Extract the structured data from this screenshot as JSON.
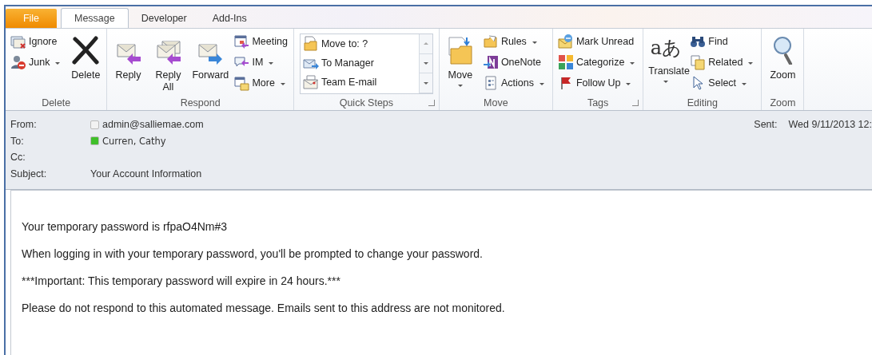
{
  "tabs": [
    {
      "label": "File",
      "kind": "file",
      "selected": false
    },
    {
      "label": "Message",
      "kind": "tab",
      "selected": true
    },
    {
      "label": "Developer",
      "kind": "tab",
      "selected": false
    },
    {
      "label": "Add-Ins",
      "kind": "tab",
      "selected": false
    }
  ],
  "groups": [
    {
      "label": "Delete",
      "launcher": false,
      "columns": [
        {
          "kind": "small",
          "items": [
            {
              "label": "Ignore",
              "dropdown": false
            },
            {
              "label": "Junk",
              "dropdown": true
            }
          ]
        },
        {
          "kind": "large",
          "items": [
            {
              "label": "Delete",
              "dropdown": false
            }
          ]
        }
      ]
    },
    {
      "label": "Respond",
      "launcher": false,
      "columns": [
        {
          "kind": "large",
          "items": [
            {
              "label": "Reply",
              "dropdown": false
            }
          ]
        },
        {
          "kind": "large",
          "items": [
            {
              "label": "Reply All",
              "dropdown": false
            }
          ]
        },
        {
          "kind": "large",
          "items": [
            {
              "label": "Forward",
              "dropdown": false
            }
          ]
        },
        {
          "kind": "small",
          "items": [
            {
              "label": "Meeting",
              "dropdown": false
            },
            {
              "label": "IM",
              "dropdown": true
            },
            {
              "label": "More",
              "dropdown": true
            }
          ]
        }
      ]
    },
    {
      "label": "Quick Steps",
      "launcher": true,
      "columns": [
        {
          "kind": "gallery",
          "items": [
            {
              "label": "Move to: ?",
              "dropdown": false
            },
            {
              "label": "To Manager",
              "dropdown": false
            },
            {
              "label": "Team E-mail",
              "dropdown": false
            }
          ]
        }
      ]
    },
    {
      "label": "Move",
      "launcher": false,
      "columns": [
        {
          "kind": "large",
          "items": [
            {
              "label": "Move",
              "dropdown": true
            }
          ]
        },
        {
          "kind": "small",
          "items": [
            {
              "label": "Rules",
              "dropdown": true
            },
            {
              "label": "OneNote",
              "dropdown": false
            },
            {
              "label": "Actions",
              "dropdown": true
            }
          ]
        }
      ]
    },
    {
      "label": "Tags",
      "launcher": true,
      "columns": [
        {
          "kind": "small",
          "items": [
            {
              "label": "Mark Unread",
              "dropdown": false
            },
            {
              "label": "Categorize",
              "dropdown": true
            },
            {
              "label": "Follow Up",
              "dropdown": true
            }
          ]
        }
      ]
    },
    {
      "label": "Editing",
      "launcher": false,
      "columns": [
        {
          "kind": "large",
          "items": [
            {
              "label": "Translate",
              "dropdown": true,
              "glyph": "aあ"
            }
          ]
        },
        {
          "kind": "small",
          "items": [
            {
              "label": "Find",
              "dropdown": false
            },
            {
              "label": "Related",
              "dropdown": true
            },
            {
              "label": "Select",
              "dropdown": true
            }
          ]
        }
      ]
    },
    {
      "label": "Zoom",
      "launcher": false,
      "columns": [
        {
          "kind": "large",
          "items": [
            {
              "label": "Zoom",
              "dropdown": false
            }
          ]
        }
      ]
    }
  ],
  "header": {
    "fields": [
      {
        "label": "From:",
        "value": "admin@salliemae.com",
        "color": "#f2f2f2"
      },
      {
        "label": "To:",
        "value": "Curren, Cathy",
        "color": "#3fbf2a"
      },
      {
        "label": "Cc:"
      },
      {
        "label": "Subject:",
        "value": "Your Account Information"
      }
    ],
    "sent": {
      "label": "Sent:",
      "value": "Wed 9/11/2013 12:"
    }
  },
  "body": {
    "paragraphs": [
      "Your temporary password is rfpaO4Nm#3",
      "When logging in with your temporary password, you'll be prompted to change your password.",
      "***Important: This temporary password will expire in 24 hours.***",
      "Please do not respond to this automated message. Emails sent to this address are not monitored."
    ]
  }
}
